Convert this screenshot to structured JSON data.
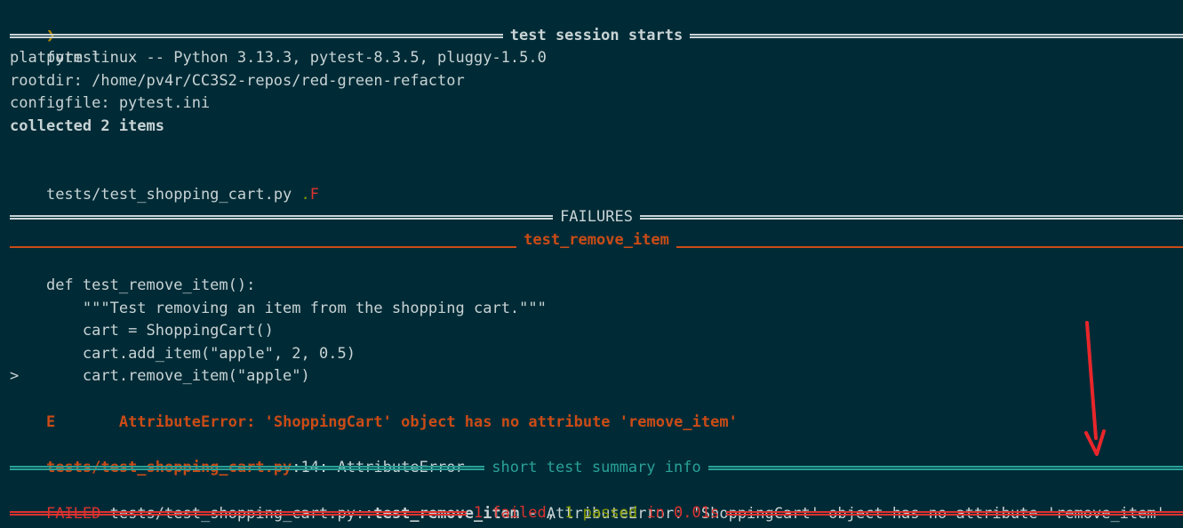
{
  "prompt": {
    "symbol": "❯",
    "command": "pytest"
  },
  "session_header": "test session starts",
  "info_lines": [
    "platform linux -- Python 3.13.3, pytest-8.3.5, pluggy-1.5.0",
    "rootdir: /home/pv4r/CC3S2-repos/red-green-refactor",
    "configfile: pytest.ini"
  ],
  "collected": "collected 2 items",
  "test_file_line": {
    "file": "tests/test_shopping_cart.py ",
    "pass_marker": ".",
    "fail_marker": "F"
  },
  "failures_header": "FAILURES",
  "failing_test_header": "test_remove_item",
  "code_lines": [
    {
      "prefix": "    ",
      "text": "def test_remove_item():"
    },
    {
      "prefix": "    ",
      "text": "    \"\"\"Test removing an item from the shopping cart.\"\"\""
    },
    {
      "prefix": "    ",
      "text": "    cart = ShoppingCart()"
    },
    {
      "prefix": "    ",
      "text": "    cart.add_item(\"apple\", 2, 0.5)"
    },
    {
      "prefix": ">   ",
      "text": "    cart.remove_item(\"apple\")"
    }
  ],
  "error_line": {
    "marker": "E",
    "text": "AttributeError: 'ShoppingCart' object has no attribute 'remove_item'"
  },
  "location_line": {
    "file": "tests/test_shopping_cart.py",
    "rest": ":14: AttributeError"
  },
  "summary_header": "short test summary info",
  "failed_line": {
    "status": "FAILED",
    "path": " tests/test_shopping_cart.py::",
    "test": "test_remove_item",
    "message": " - AttributeError: 'ShoppingCart' object has no attribute 'remove_item'"
  },
  "result_line": {
    "failed": "1 failed",
    "comma": ", ",
    "passed": "1 passed",
    "time": " in 0.01s"
  },
  "colors": {
    "background": "#002b36",
    "text": "#c8d3d5",
    "teal": "#2aa198",
    "orange": "#cb4b16",
    "red": "#dc322f",
    "green": "#859900",
    "arrow": "#e8262b"
  }
}
